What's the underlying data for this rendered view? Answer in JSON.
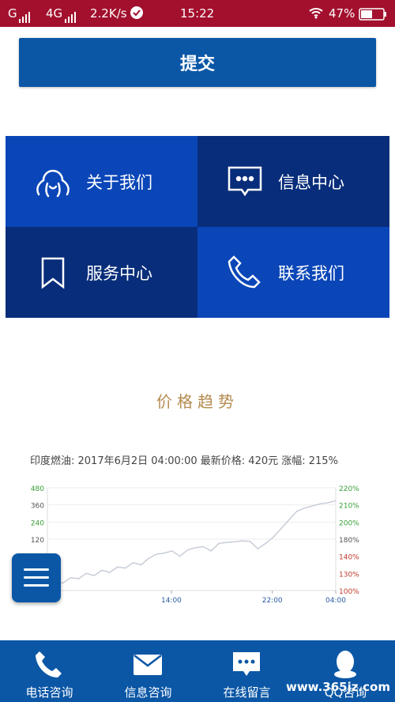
{
  "status": {
    "carrier1": "G",
    "carrier2": "4G",
    "speed": "2.2K/s",
    "time": "15:22",
    "battery": "47%"
  },
  "submit_label": "提交",
  "tiles": [
    {
      "label": "关于我们",
      "icon": "octopus-icon",
      "color": "#0a46b8"
    },
    {
      "label": "信息中心",
      "icon": "message-icon",
      "color": "#082d7a"
    },
    {
      "label": "服务中心",
      "icon": "bookmark-icon",
      "color": "#082d7a"
    },
    {
      "label": "联系我们",
      "icon": "phone-icon",
      "color": "#0a46b8"
    }
  ],
  "price": {
    "title": "价格趋势",
    "info": "印度燃油: 2017年6月2日 04:00:00  最新价格: 420元  涨幅: 215%"
  },
  "chart_data": {
    "type": "line",
    "left_ticks": [
      "480",
      "360",
      "240",
      "120"
    ],
    "right_ticks": [
      "220%",
      "210%",
      "200%",
      "180%",
      "140%",
      "130%",
      "100%"
    ],
    "x_ticks": [
      "14:00",
      "22:00",
      "04:00"
    ],
    "y_range": [
      0,
      480
    ],
    "series": [
      {
        "values": [
          20,
          40,
          35,
          60,
          55,
          80,
          70,
          95,
          85,
          110,
          105,
          130,
          120,
          150,
          170,
          175,
          185,
          160,
          190,
          200,
          205,
          185,
          220,
          225,
          228,
          232,
          230,
          195,
          220,
          250,
          290,
          330,
          370,
          385,
          395,
          405,
          410,
          420
        ]
      }
    ],
    "grid": true,
    "line_color": "#c8cdd8"
  },
  "footer": [
    {
      "label": "电话咨询",
      "icon": "phone-icon"
    },
    {
      "label": "信息咨询",
      "icon": "mail-icon"
    },
    {
      "label": "在线留言",
      "icon": "chat-icon"
    },
    {
      "label": "QQ咨询",
      "icon": "qq-icon"
    }
  ],
  "watermark": "www.365jz.com"
}
